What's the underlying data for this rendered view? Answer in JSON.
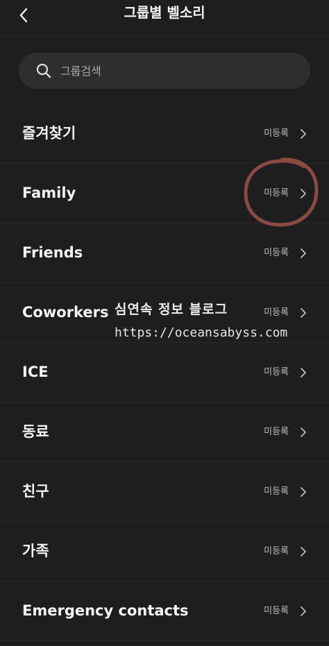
{
  "header": {
    "title": "그룹별 벨소리",
    "back_icon": "chevron-left-icon"
  },
  "search": {
    "placeholder": "그룹검색",
    "value": "",
    "icon": "search-icon"
  },
  "groups": [
    {
      "label": "즐겨찾기",
      "status": "미등록"
    },
    {
      "label": "Family",
      "status": "미등록"
    },
    {
      "label": "Friends",
      "status": "미등록"
    },
    {
      "label": "Coworkers",
      "status": "미등록"
    },
    {
      "label": "ICE",
      "status": "미등록"
    },
    {
      "label": "동료",
      "status": "미등록"
    },
    {
      "label": "친구",
      "status": "미등록"
    },
    {
      "label": "가족",
      "status": "미등록"
    },
    {
      "label": "Emergency contacts",
      "status": "미등록"
    }
  ],
  "watermark": {
    "title": "심연속 정보 블로그",
    "url": "https://oceansabyss.com"
  },
  "colors": {
    "background": "#1e1e1e",
    "search_bg": "#2e2e2e",
    "annotation_circle": "#8a4a42"
  }
}
